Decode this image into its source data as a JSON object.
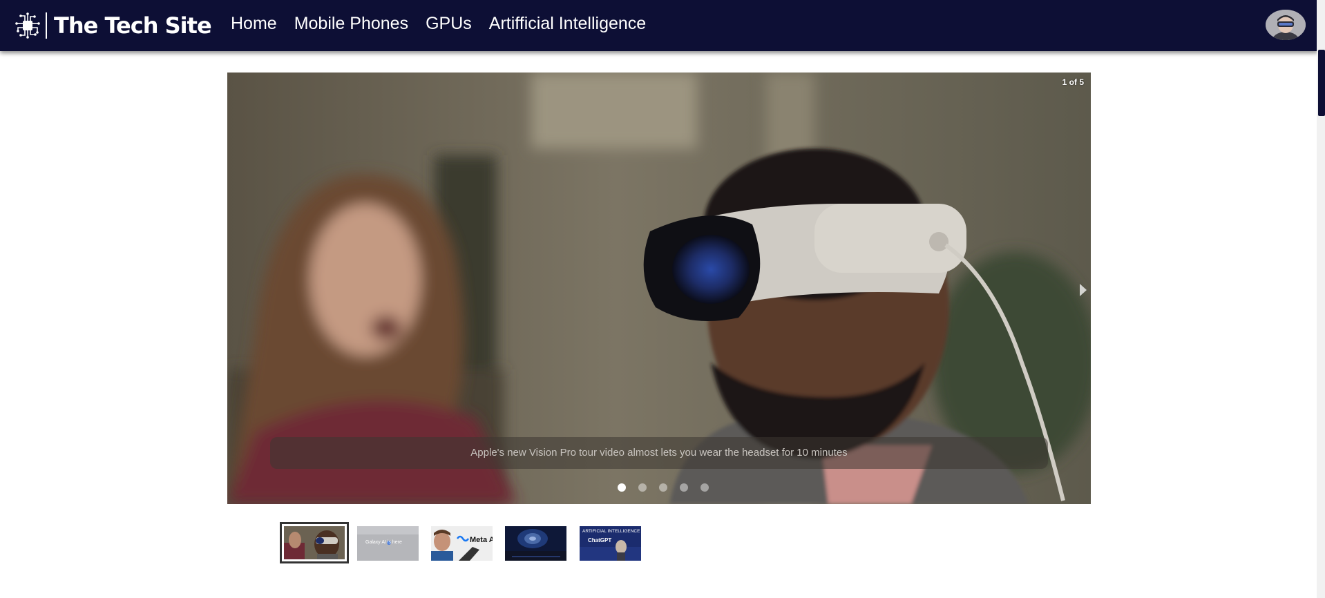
{
  "site": {
    "brand_title": "The Tech Site",
    "brand_icon": "circuit-chip-icon"
  },
  "nav": {
    "links": [
      {
        "label": "Home"
      },
      {
        "label": "Mobile Phones"
      },
      {
        "label": "GPUs"
      },
      {
        "label": "Artifficial Intelligence"
      }
    ],
    "avatar_icon": "user-avatar-icon"
  },
  "carousel": {
    "counter": "1 of 5",
    "caption": "Apple's new Vision Pro tour video almost lets you wear the headset for 10 minutes",
    "current_slide": 1,
    "total_slides": 5,
    "next_icon": "chevron-right-icon"
  },
  "thumbnails": [
    {
      "name": "vision-pro-thumbnail",
      "text": ""
    },
    {
      "name": "galaxy-ai-thumbnail",
      "text": "Galaxy AI is here"
    },
    {
      "name": "meta-ai-thumbnail",
      "text": "Meta AI"
    },
    {
      "name": "gpu-thumbnail",
      "text": ""
    },
    {
      "name": "chatgpt-thumbnail",
      "text_top": "ARTIFICIAL INTELLIGENCE",
      "text_bottom": "ChatGPT"
    }
  ],
  "colors": {
    "navbar_bg": "#0d0f35",
    "nav_text": "#ffffff",
    "page_bg": "#ffffff",
    "scrollbar_thumb": "#0d0f35"
  }
}
